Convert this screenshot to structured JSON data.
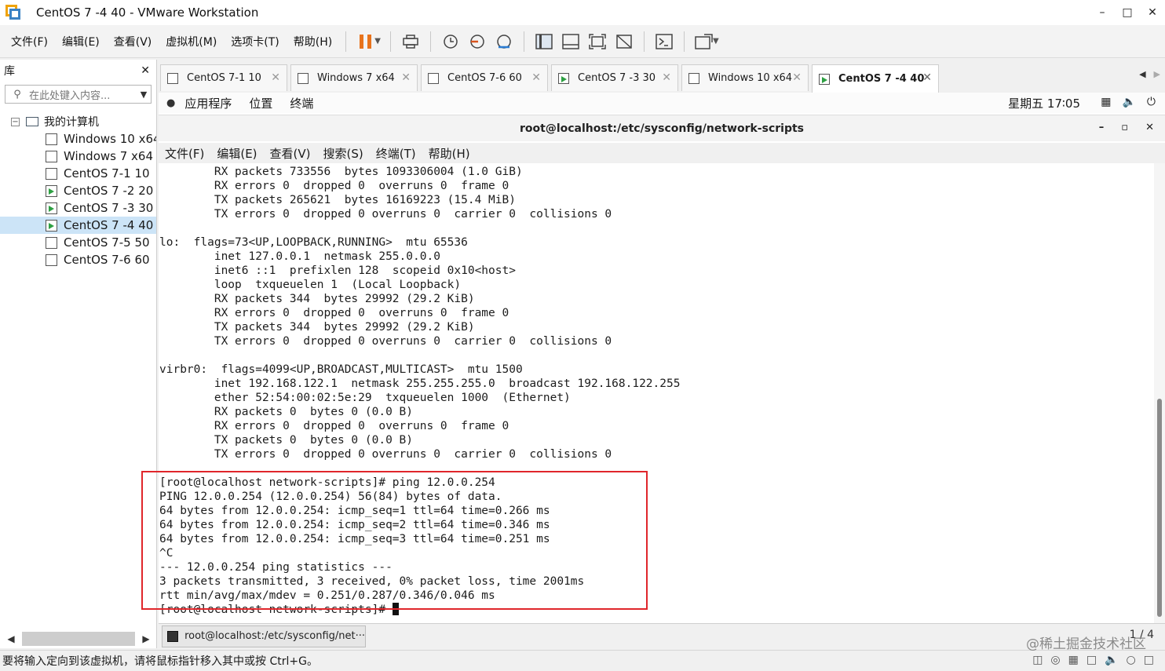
{
  "window": {
    "title": "CentOS 7 -4 40 - VMware Workstation",
    "minimize": "–",
    "maximize": "□",
    "close": "✕"
  },
  "menu": [
    "文件(F)",
    "编辑(E)",
    "查看(V)",
    "虚拟机(M)",
    "选项卡(T)",
    "帮助(H)"
  ],
  "library": {
    "title": "库",
    "close": "✕",
    "search_placeholder": "在此处键入内容...",
    "root": "我的计算机",
    "items": [
      {
        "name": "Windows 10 x64",
        "running": false,
        "selected": false
      },
      {
        "name": "Windows 7 x64",
        "running": false,
        "selected": false
      },
      {
        "name": "CentOS 7-1  10",
        "running": false,
        "selected": false
      },
      {
        "name": "CentOS 7 -2 20",
        "running": true,
        "selected": false
      },
      {
        "name": "CentOS 7 -3 30",
        "running": true,
        "selected": false
      },
      {
        "name": "CentOS 7 -4 40",
        "running": true,
        "selected": true
      },
      {
        "name": "CentOS 7-5 50",
        "running": false,
        "selected": false
      },
      {
        "name": "CentOS 7-6  60",
        "running": false,
        "selected": false
      }
    ]
  },
  "tabs": [
    {
      "label": "CentOS 7-1  10",
      "running": false,
      "active": false
    },
    {
      "label": "Windows 7 x64",
      "running": false,
      "active": false
    },
    {
      "label": "CentOS 7-6  60",
      "running": false,
      "active": false
    },
    {
      "label": "CentOS 7 -3 30",
      "running": true,
      "active": false
    },
    {
      "label": "Windows 10 x64",
      "running": false,
      "active": false
    },
    {
      "label": "CentOS 7 -4 40",
      "running": true,
      "active": true
    }
  ],
  "gnome": {
    "apps": "应用程序",
    "places": "位置",
    "terminal": "终端",
    "clock": "星期五 17∶05"
  },
  "terminal": {
    "title": "root@localhost:/etc/sysconfig/network-scripts",
    "menu": [
      "文件(F)",
      "编辑(E)",
      "查看(V)",
      "搜索(S)",
      "终端(T)",
      "帮助(H)"
    ],
    "lines": [
      "        RX packets 733556  bytes 1093306004 (1.0 GiB)",
      "        RX errors 0  dropped 0  overruns 0  frame 0",
      "        TX packets 265621  bytes 16169223 (15.4 MiB)",
      "        TX errors 0  dropped 0 overruns 0  carrier 0  collisions 0",
      "",
      "lo:  flags=73<UP,LOOPBACK,RUNNING>  mtu 65536",
      "        inet 127.0.0.1  netmask 255.0.0.0",
      "        inet6 ::1  prefixlen 128  scopeid 0x10<host>",
      "        loop  txqueuelen 1  (Local Loopback)",
      "        RX packets 344  bytes 29992 (29.2 KiB)",
      "        RX errors 0  dropped 0  overruns 0  frame 0",
      "        TX packets 344  bytes 29992 (29.2 KiB)",
      "        TX errors 0  dropped 0 overruns 0  carrier 0  collisions 0",
      "",
      "virbr0:  flags=4099<UP,BROADCAST,MULTICAST>  mtu 1500",
      "        inet 192.168.122.1  netmask 255.255.255.0  broadcast 192.168.122.255",
      "        ether 52:54:00:02:5e:29  txqueuelen 1000  (Ethernet)",
      "        RX packets 0  bytes 0 (0.0 B)",
      "        RX errors 0  dropped 0  overruns 0  frame 0",
      "        TX packets 0  bytes 0 (0.0 B)",
      "        TX errors 0  dropped 0 overruns 0  carrier 0  collisions 0",
      "",
      "[root@localhost network-scripts]# ping 12.0.0.254",
      "PING 12.0.0.254 (12.0.0.254) 56(84) bytes of data.",
      "64 bytes from 12.0.0.254: icmp_seq=1 ttl=64 time=0.266 ms",
      "64 bytes from 12.0.0.254: icmp_seq=2 ttl=64 time=0.346 ms",
      "64 bytes from 12.0.0.254: icmp_seq=3 ttl=64 time=0.251 ms",
      "^C",
      "--- 12.0.0.254 ping statistics ---",
      "3 packets transmitted, 3 received, 0% packet loss, time 2001ms",
      "rtt min/avg/max/mdev = 0.251/0.287/0.346/0.046 ms"
    ],
    "prompt": "[root@localhost network-scripts]# "
  },
  "taskbar": {
    "item": "root@localhost:/etc/sysconfig/net···",
    "page": "1 / 4"
  },
  "status": {
    "message": "要将输入定向到该虚拟机，请将鼠标指针移入其中或按 Ctrl+G。"
  },
  "watermark": "@稀土掘金技术社区",
  "colors": {
    "highlight_box": "#e0262b",
    "running_icon": "#2ea043",
    "selected_row": "#cce4f7"
  }
}
